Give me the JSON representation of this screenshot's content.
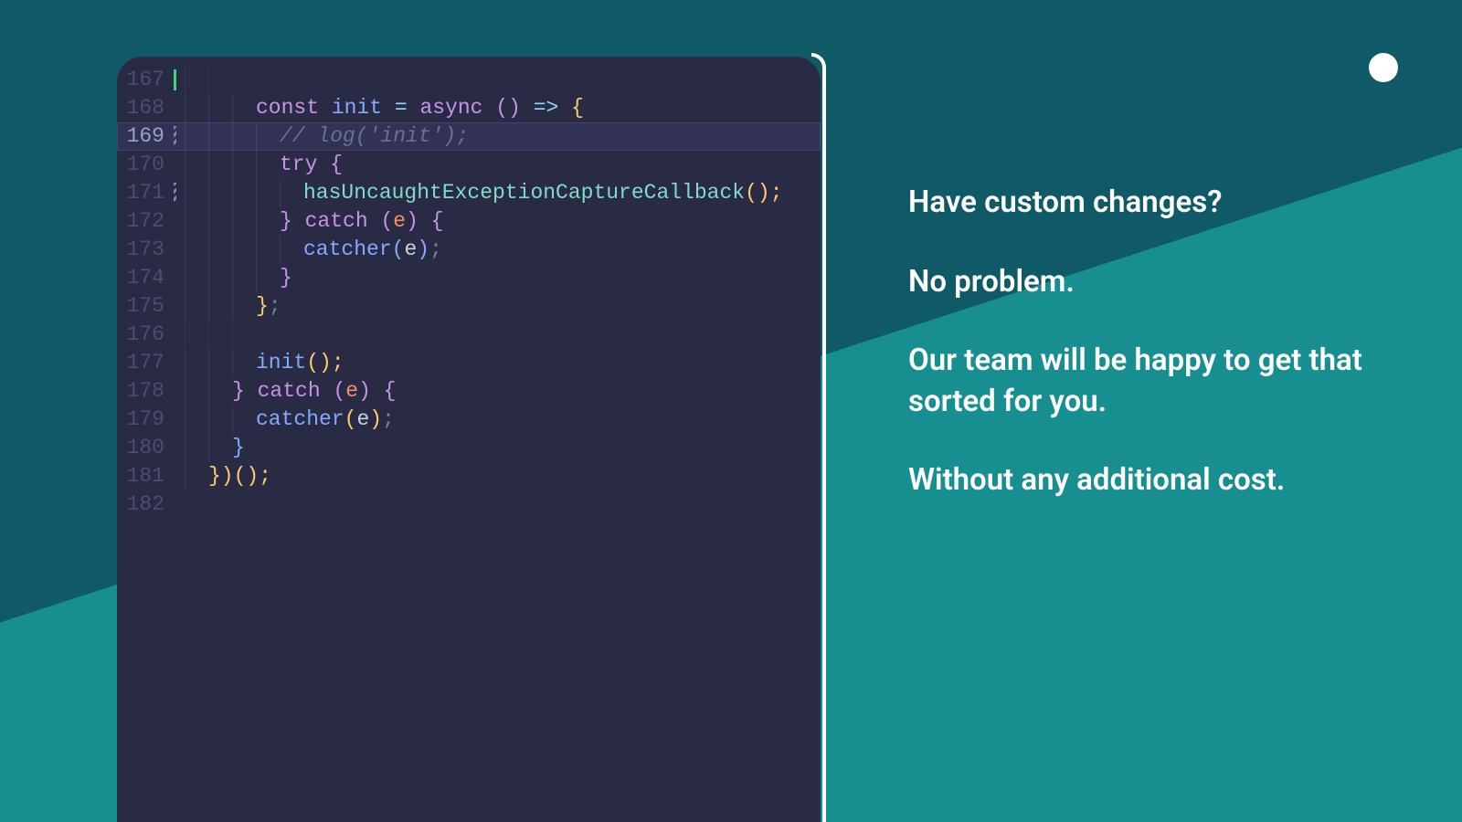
{
  "design": {
    "bg_primary": "#178f91",
    "bg_accent": "#0f5a66",
    "editor_bg": "#292a43",
    "highlight_bg": "#313254"
  },
  "editor": {
    "first_line": 167,
    "highlighted_line": 169,
    "lines": {
      "l167": {
        "num": "167"
      },
      "l168": {
        "num": "168",
        "kw_const": "const",
        "id_init": "init",
        "op_eq": " = ",
        "kw_async": "async",
        "parens": " () ",
        "op_arrow": "=>",
        "brace_open": " {"
      },
      "l169": {
        "num": "169",
        "comment": "// log('init');"
      },
      "l170": {
        "num": "170",
        "kw_try": "try",
        "brace_open": " {"
      },
      "l171": {
        "num": "171",
        "call": "hasUncaughtExceptionCaptureCallback",
        "parens": "();"
      },
      "l172": {
        "num": "172",
        "brace_close": "}",
        "kw_catch": " catch ",
        "paren_open": "(",
        "param_e": "e",
        "paren_close": ")",
        "brace_open": " {"
      },
      "l173": {
        "num": "173",
        "call": "catcher",
        "paren_open": "(",
        "param_e": "e",
        "paren_close": ")",
        "semi": ";"
      },
      "l174": {
        "num": "174",
        "brace_close": "}"
      },
      "l175": {
        "num": "175",
        "brace_close": "}",
        "semi": ";"
      },
      "l176": {
        "num": "176"
      },
      "l177": {
        "num": "177",
        "call": "init",
        "parens": "();"
      },
      "l178": {
        "num": "178",
        "brace_close": "}",
        "kw_catch": " catch ",
        "paren_open": "(",
        "param_e": "e",
        "paren_close": ")",
        "brace_open": " {"
      },
      "l179": {
        "num": "179",
        "call": "catcher",
        "paren_open": "(",
        "param_e": "e",
        "paren_close": ")",
        "semi": ";"
      },
      "l180": {
        "num": "180",
        "brace_close": "}"
      },
      "l181": {
        "num": "181",
        "tail": "})();"
      },
      "l182": {
        "num": "182"
      }
    }
  },
  "copy": {
    "p1": "Have custom changes?",
    "p2": "No problem.",
    "p3": "Our team will be happy to get that sorted for you.",
    "p4": "Without any additional cost."
  }
}
